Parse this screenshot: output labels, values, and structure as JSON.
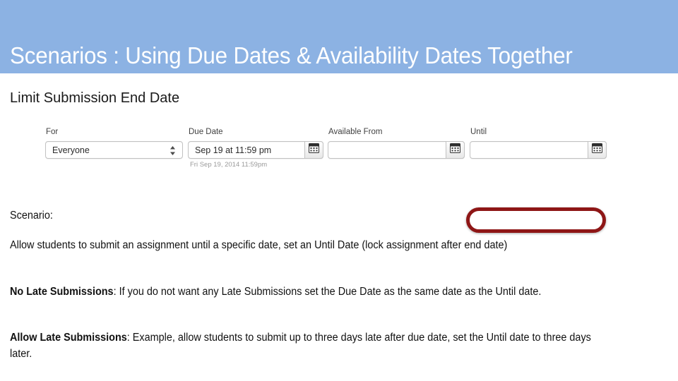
{
  "slide": {
    "title": "Scenarios : Using Due Dates & Availability Dates Together",
    "heading": "Limit Submission End Date"
  },
  "colors": {
    "banner_blue": "#8CB2E3",
    "title_text": "#FFFFFF",
    "highlight_red": "#8E1616",
    "body_text": "#111111",
    "helper_text": "#9A9A9A"
  },
  "form": {
    "columns": [
      {
        "label": "For",
        "control": "select",
        "value": "Everyone",
        "icon": "stepper-arrows-icon",
        "helper": ""
      },
      {
        "label": "Due Date",
        "control": "date-input",
        "value": "Sep 19 at 11:59 pm",
        "icon": "calendar-icon",
        "helper": "Fri Sep 19, 2014 11:59pm"
      },
      {
        "label": "Available From",
        "control": "date-input",
        "value": "",
        "icon": "calendar-icon",
        "helper": ""
      },
      {
        "label": "Until",
        "control": "date-input",
        "value": "",
        "icon": "calendar-icon",
        "helper": "",
        "highlighted": true
      }
    ]
  },
  "paragraphs": {
    "scenario_label": "Scenario:",
    "allow_body": "Allow students to submit an assignment until a specific date, set an Until Date (lock assignment after end date)",
    "no_late_lead": "No Late Submissions",
    "no_late_body": ": If you do not want any Late Submissions set the Due Date as the same date as the Until date.",
    "allow_late_lead": "Allow Late Submissions",
    "allow_late_body": ": Example, allow students to submit up to three days late after due date, set the Until date to three days later."
  }
}
